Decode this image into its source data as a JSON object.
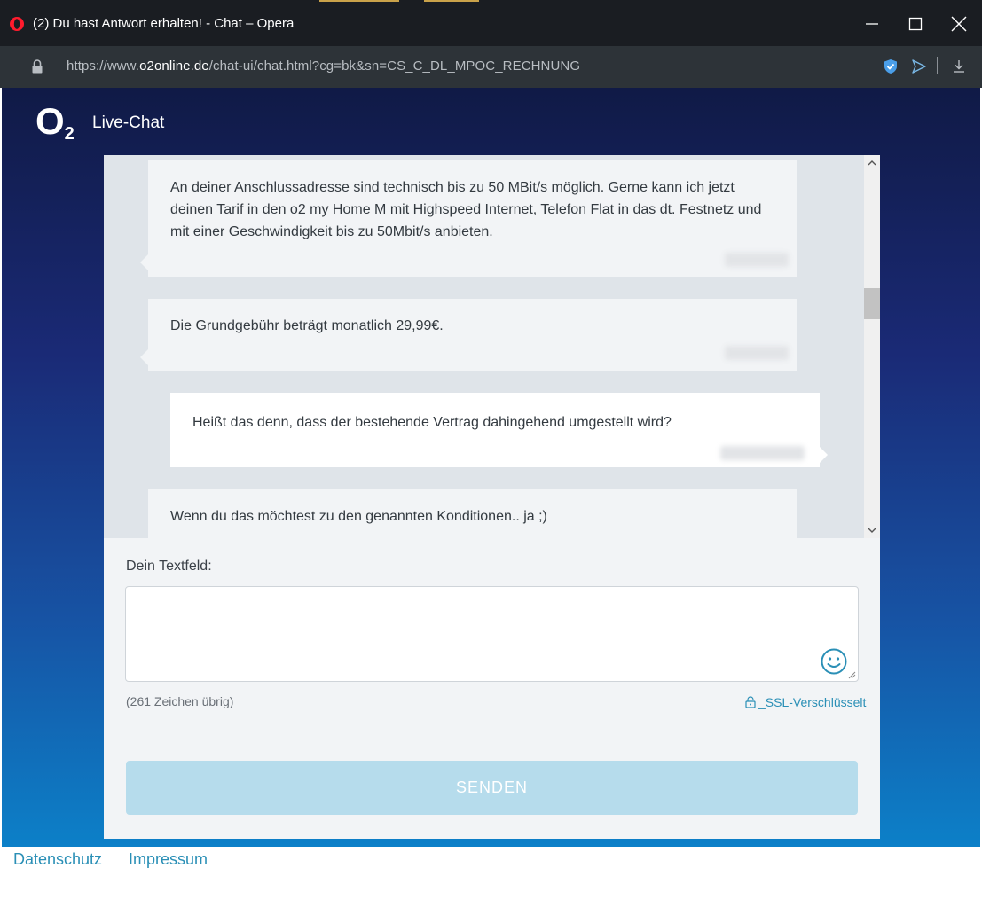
{
  "window": {
    "title": "(2) Du hast Antwort erhalten! - Chat – Opera"
  },
  "address_bar": {
    "url_prefix": "https://www.",
    "url_domain": "o2online.de",
    "url_path": "/chat-ui/chat.html?cg=bk&sn=CS_C_DL_MPOC_RECHNUNG"
  },
  "header": {
    "logo_text": "O",
    "logo_sub": "2",
    "title": "Live-Chat"
  },
  "messages": [
    {
      "sender": "agent",
      "text": "An deiner Anschlussadresse sind technisch bis zu 50 MBit/s möglich. Gerne kann ich jetzt deinen Tarif in den o2 my Home M mit Highspeed Internet, Telefon Flat in das dt. Festnetz und mit einer Geschwindigkeit bis zu 50Mbit/s anbieten."
    },
    {
      "sender": "agent",
      "text": "Die Grundgebühr beträgt monatlich 29,99€."
    },
    {
      "sender": "user",
      "text": "Heißt das denn, dass der bestehende Vertrag dahingehend umgestellt wird?"
    },
    {
      "sender": "agent",
      "text": "Wenn du das möchtest zu den genannten Konditionen.. ja ;)"
    }
  ],
  "input": {
    "label": "Dein Textfeld:",
    "value": "",
    "char_count": "(261 Zeichen übrig)",
    "ssl_label": "_SSL-Verschlüsselt",
    "send_label": "SENDEN"
  },
  "footer": {
    "links": [
      "Datenschutz",
      "Impressum"
    ]
  },
  "colors": {
    "send_button": "#b6dcec",
    "link": "#2a8fb6"
  }
}
